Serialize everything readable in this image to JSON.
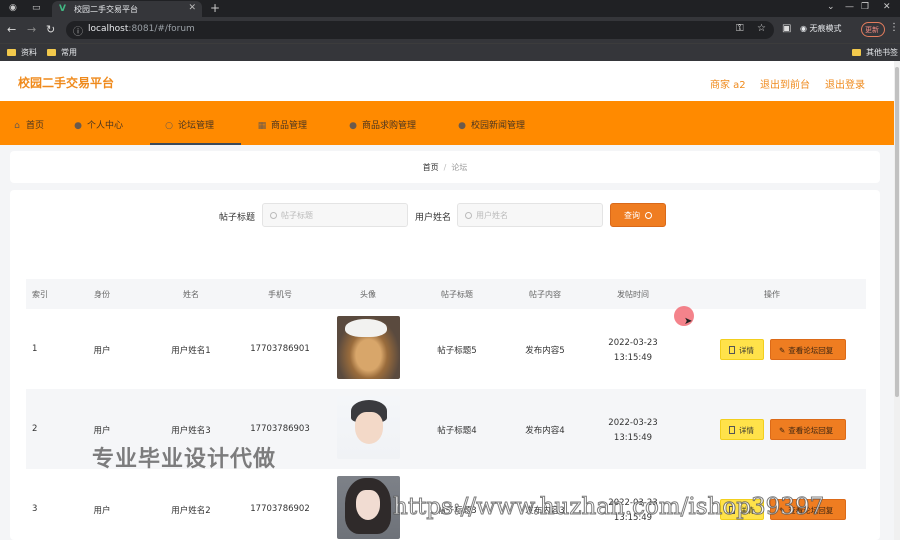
{
  "browser": {
    "tab_title": "校园二手交易平台",
    "url_host": "localhost",
    "url_path": ":8081/#/forum",
    "incognito_label": "无痕模式",
    "update_label": "更新",
    "bookmarks": [
      "资料",
      "常用"
    ],
    "other_bookmarks": "其他书签"
  },
  "header": {
    "title": "校园二手交易平台",
    "user": "商家 a2",
    "backend_link": "退出到前台",
    "logout_link": "退出登录"
  },
  "nav": [
    {
      "label": "首页"
    },
    {
      "label": "个人中心"
    },
    {
      "label": "论坛管理"
    },
    {
      "label": "商品管理"
    },
    {
      "label": "商品求购管理"
    },
    {
      "label": "校园新闻管理"
    }
  ],
  "breadcrumb": {
    "home": "首页",
    "separator": "/",
    "current": "论坛"
  },
  "search": {
    "title_label": "帖子标题",
    "title_placeholder": "帖子标题",
    "user_label": "用户姓名",
    "user_placeholder": "用户姓名",
    "query_button": "查询"
  },
  "table": {
    "columns": [
      "索引",
      "身份",
      "姓名",
      "手机号",
      "头像",
      "帖子标题",
      "帖子内容",
      "发帖时间",
      "操作"
    ],
    "rows": [
      {
        "index": "1",
        "identity": "用户",
        "name": "用户姓名1",
        "phone": "17703786901",
        "title": "帖子标题5",
        "content": "发布内容5",
        "time": "2022-03-23 13:15:49"
      },
      {
        "index": "2",
        "identity": "用户",
        "name": "用户姓名3",
        "phone": "17703786903",
        "title": "帖子标题4",
        "content": "发布内容4",
        "time": "2022-03-23 13:15:49"
      },
      {
        "index": "3",
        "identity": "用户",
        "name": "用户姓名2",
        "phone": "17703786902",
        "title": "帖子标题3",
        "content": "发布内容3",
        "time": "2022-03-23 13:15:49"
      }
    ],
    "detail_button": "详情",
    "reply_button": "查看论坛回复"
  },
  "watermark": {
    "text1": "专业毕业设计代做",
    "text2": "https://www.huzhan.com/ishop39397"
  }
}
